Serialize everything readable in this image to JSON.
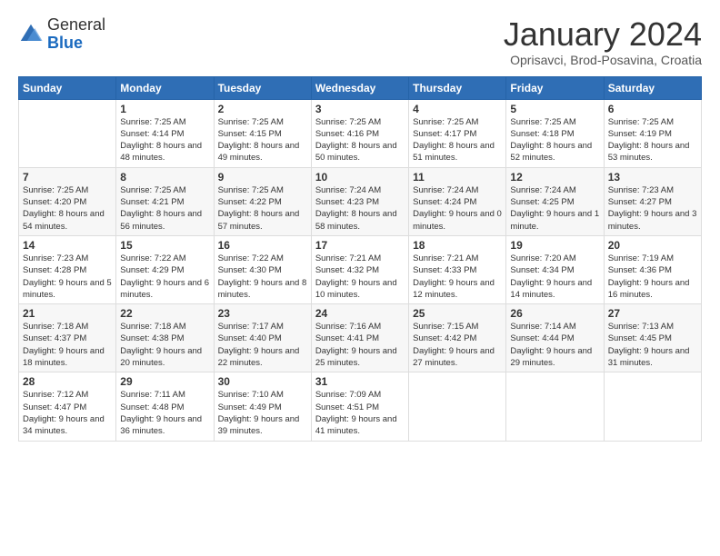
{
  "logo": {
    "general": "General",
    "blue": "Blue"
  },
  "header": {
    "month": "January 2024",
    "location": "Oprisavci, Brod-Posavina, Croatia"
  },
  "weekdays": [
    "Sunday",
    "Monday",
    "Tuesday",
    "Wednesday",
    "Thursday",
    "Friday",
    "Saturday"
  ],
  "weeks": [
    [
      {
        "day": "",
        "sunrise": "",
        "sunset": "",
        "daylight": ""
      },
      {
        "day": "1",
        "sunrise": "Sunrise: 7:25 AM",
        "sunset": "Sunset: 4:14 PM",
        "daylight": "Daylight: 8 hours and 48 minutes."
      },
      {
        "day": "2",
        "sunrise": "Sunrise: 7:25 AM",
        "sunset": "Sunset: 4:15 PM",
        "daylight": "Daylight: 8 hours and 49 minutes."
      },
      {
        "day": "3",
        "sunrise": "Sunrise: 7:25 AM",
        "sunset": "Sunset: 4:16 PM",
        "daylight": "Daylight: 8 hours and 50 minutes."
      },
      {
        "day": "4",
        "sunrise": "Sunrise: 7:25 AM",
        "sunset": "Sunset: 4:17 PM",
        "daylight": "Daylight: 8 hours and 51 minutes."
      },
      {
        "day": "5",
        "sunrise": "Sunrise: 7:25 AM",
        "sunset": "Sunset: 4:18 PM",
        "daylight": "Daylight: 8 hours and 52 minutes."
      },
      {
        "day": "6",
        "sunrise": "Sunrise: 7:25 AM",
        "sunset": "Sunset: 4:19 PM",
        "daylight": "Daylight: 8 hours and 53 minutes."
      }
    ],
    [
      {
        "day": "7",
        "sunrise": "Sunrise: 7:25 AM",
        "sunset": "Sunset: 4:20 PM",
        "daylight": "Daylight: 8 hours and 54 minutes."
      },
      {
        "day": "8",
        "sunrise": "Sunrise: 7:25 AM",
        "sunset": "Sunset: 4:21 PM",
        "daylight": "Daylight: 8 hours and 56 minutes."
      },
      {
        "day": "9",
        "sunrise": "Sunrise: 7:25 AM",
        "sunset": "Sunset: 4:22 PM",
        "daylight": "Daylight: 8 hours and 57 minutes."
      },
      {
        "day": "10",
        "sunrise": "Sunrise: 7:24 AM",
        "sunset": "Sunset: 4:23 PM",
        "daylight": "Daylight: 8 hours and 58 minutes."
      },
      {
        "day": "11",
        "sunrise": "Sunrise: 7:24 AM",
        "sunset": "Sunset: 4:24 PM",
        "daylight": "Daylight: 9 hours and 0 minutes."
      },
      {
        "day": "12",
        "sunrise": "Sunrise: 7:24 AM",
        "sunset": "Sunset: 4:25 PM",
        "daylight": "Daylight: 9 hours and 1 minute."
      },
      {
        "day": "13",
        "sunrise": "Sunrise: 7:23 AM",
        "sunset": "Sunset: 4:27 PM",
        "daylight": "Daylight: 9 hours and 3 minutes."
      }
    ],
    [
      {
        "day": "14",
        "sunrise": "Sunrise: 7:23 AM",
        "sunset": "Sunset: 4:28 PM",
        "daylight": "Daylight: 9 hours and 5 minutes."
      },
      {
        "day": "15",
        "sunrise": "Sunrise: 7:22 AM",
        "sunset": "Sunset: 4:29 PM",
        "daylight": "Daylight: 9 hours and 6 minutes."
      },
      {
        "day": "16",
        "sunrise": "Sunrise: 7:22 AM",
        "sunset": "Sunset: 4:30 PM",
        "daylight": "Daylight: 9 hours and 8 minutes."
      },
      {
        "day": "17",
        "sunrise": "Sunrise: 7:21 AM",
        "sunset": "Sunset: 4:32 PM",
        "daylight": "Daylight: 9 hours and 10 minutes."
      },
      {
        "day": "18",
        "sunrise": "Sunrise: 7:21 AM",
        "sunset": "Sunset: 4:33 PM",
        "daylight": "Daylight: 9 hours and 12 minutes."
      },
      {
        "day": "19",
        "sunrise": "Sunrise: 7:20 AM",
        "sunset": "Sunset: 4:34 PM",
        "daylight": "Daylight: 9 hours and 14 minutes."
      },
      {
        "day": "20",
        "sunrise": "Sunrise: 7:19 AM",
        "sunset": "Sunset: 4:36 PM",
        "daylight": "Daylight: 9 hours and 16 minutes."
      }
    ],
    [
      {
        "day": "21",
        "sunrise": "Sunrise: 7:18 AM",
        "sunset": "Sunset: 4:37 PM",
        "daylight": "Daylight: 9 hours and 18 minutes."
      },
      {
        "day": "22",
        "sunrise": "Sunrise: 7:18 AM",
        "sunset": "Sunset: 4:38 PM",
        "daylight": "Daylight: 9 hours and 20 minutes."
      },
      {
        "day": "23",
        "sunrise": "Sunrise: 7:17 AM",
        "sunset": "Sunset: 4:40 PM",
        "daylight": "Daylight: 9 hours and 22 minutes."
      },
      {
        "day": "24",
        "sunrise": "Sunrise: 7:16 AM",
        "sunset": "Sunset: 4:41 PM",
        "daylight": "Daylight: 9 hours and 25 minutes."
      },
      {
        "day": "25",
        "sunrise": "Sunrise: 7:15 AM",
        "sunset": "Sunset: 4:42 PM",
        "daylight": "Daylight: 9 hours and 27 minutes."
      },
      {
        "day": "26",
        "sunrise": "Sunrise: 7:14 AM",
        "sunset": "Sunset: 4:44 PM",
        "daylight": "Daylight: 9 hours and 29 minutes."
      },
      {
        "day": "27",
        "sunrise": "Sunrise: 7:13 AM",
        "sunset": "Sunset: 4:45 PM",
        "daylight": "Daylight: 9 hours and 31 minutes."
      }
    ],
    [
      {
        "day": "28",
        "sunrise": "Sunrise: 7:12 AM",
        "sunset": "Sunset: 4:47 PM",
        "daylight": "Daylight: 9 hours and 34 minutes."
      },
      {
        "day": "29",
        "sunrise": "Sunrise: 7:11 AM",
        "sunset": "Sunset: 4:48 PM",
        "daylight": "Daylight: 9 hours and 36 minutes."
      },
      {
        "day": "30",
        "sunrise": "Sunrise: 7:10 AM",
        "sunset": "Sunset: 4:49 PM",
        "daylight": "Daylight: 9 hours and 39 minutes."
      },
      {
        "day": "31",
        "sunrise": "Sunrise: 7:09 AM",
        "sunset": "Sunset: 4:51 PM",
        "daylight": "Daylight: 9 hours and 41 minutes."
      },
      {
        "day": "",
        "sunrise": "",
        "sunset": "",
        "daylight": ""
      },
      {
        "day": "",
        "sunrise": "",
        "sunset": "",
        "daylight": ""
      },
      {
        "day": "",
        "sunrise": "",
        "sunset": "",
        "daylight": ""
      }
    ]
  ]
}
